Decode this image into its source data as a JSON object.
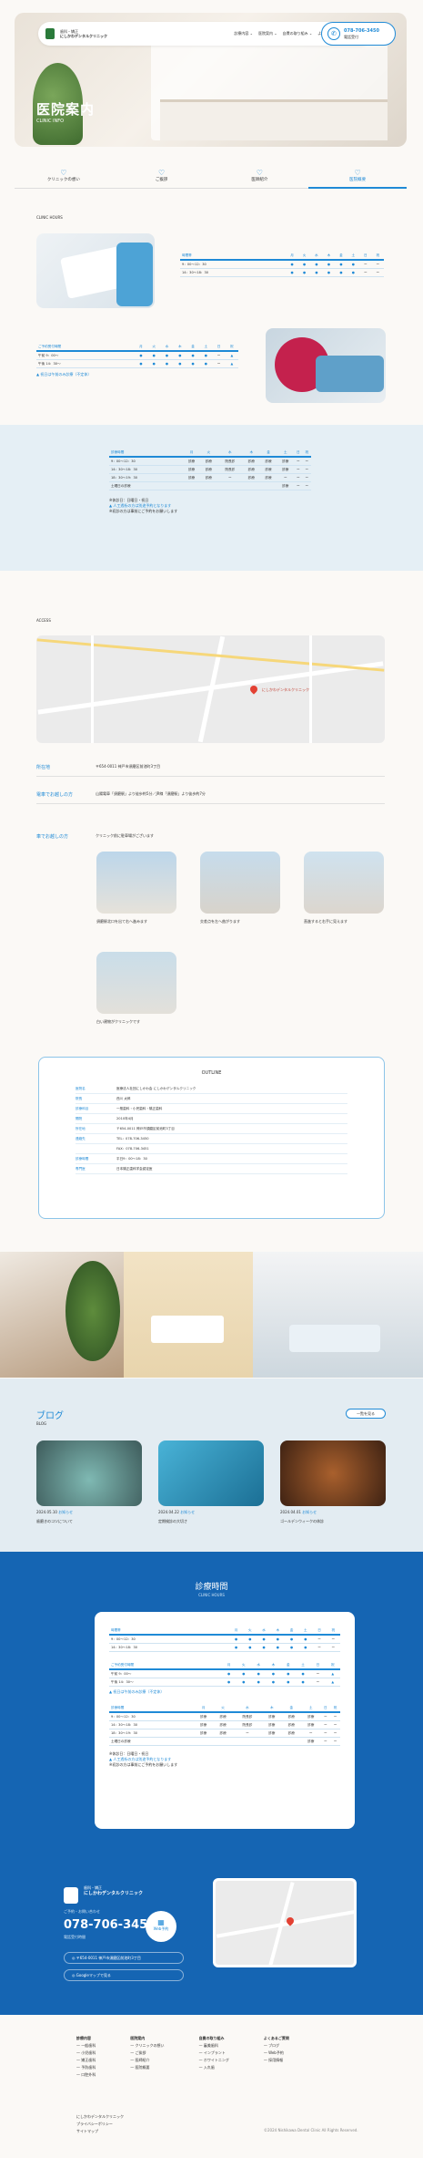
{
  "header": {
    "clinic_small": "歯科・矯正",
    "clinic_name": "にしかわデンタルクリニック",
    "nav": [
      "診療内容 ⌄",
      "医院案内 ⌄",
      "自費の取り組み ⌄",
      "よくあるご質問",
      "Web予約"
    ],
    "tel_label": "078-706-3450",
    "tel_sub": "電話受付"
  },
  "hero": {
    "title": "医院案内",
    "subtitle": "CLINIC INFO"
  },
  "tabs": [
    {
      "icon": "♡",
      "label": "クリニックの想い"
    },
    {
      "icon": "♡",
      "label": "ご挨拶"
    },
    {
      "icon": "♡",
      "label": "医師紹介"
    },
    {
      "icon": "♡",
      "label": "医院概要"
    }
  ],
  "hours_section": {
    "heading": "CLINIC HOURS"
  },
  "table1": {
    "head": [
      "時間帯",
      "月",
      "火",
      "水",
      "木",
      "金",
      "土",
      "日",
      "祝"
    ],
    "rows": [
      [
        "9：00〜12：30",
        "●",
        "●",
        "●",
        "●",
        "●",
        "●",
        "ー",
        "ー"
      ],
      [
        "14：30〜18：30",
        "●",
        "●",
        "●",
        "●",
        "●",
        "●",
        "ー",
        "ー"
      ]
    ]
  },
  "table2": {
    "head": [
      "ご予約受付時間",
      "月",
      "火",
      "水",
      "木",
      "金",
      "土",
      "日",
      "祝"
    ],
    "rows": [
      [
        "午前 9：00〜",
        "●",
        "●",
        "●",
        "●",
        "●",
        "●",
        "ー",
        "▲"
      ],
      [
        "午後 14：30〜",
        "●",
        "●",
        "●",
        "●",
        "●",
        "●",
        "ー",
        "▲"
      ]
    ],
    "note": "▲ 祝日は午前のみ診療（不定休）"
  },
  "table3": {
    "head": [
      "診療時間",
      "月",
      "火",
      "水",
      "木",
      "金",
      "土",
      "日",
      "祝"
    ],
    "rows": [
      [
        "9：00〜12：30",
        "診療",
        "診療",
        "院長診",
        "診療",
        "診療",
        "診療",
        "ー",
        "ー"
      ],
      [
        "14：30〜18：30",
        "診療",
        "診療",
        "院長診",
        "診療",
        "診療",
        "診療",
        "ー",
        "ー"
      ],
      [
        "18：30〜19：30",
        "診療",
        "診療",
        "ー",
        "診療",
        "診療",
        "ー",
        "ー",
        "ー"
      ],
      [
        "土曜日の診療",
        "",
        "",
        "",
        "",
        "",
        "診療",
        "ー",
        "ー"
      ]
    ],
    "notes": [
      "※休診日：日曜日・祝日",
      "▲ 人工透析の方は別途予約となります",
      "※初診の方は事前にご予約をお願いします"
    ]
  },
  "access": {
    "heading": "ACCESS",
    "map_label": "にしかわデンタルクリニック",
    "rows": [
      {
        "k": "所在地",
        "v": "〒654-0011 神戸市須磨区前池町3丁目"
      },
      {
        "k": "電車でお越しの方",
        "v": "山陽電車「須磨駅」より徒歩約5分／JR線「須磨駅」より徒歩約7分"
      },
      {
        "k": "車でお越しの方",
        "v": "クリニック前に駐車場がございます"
      }
    ],
    "steps": [
      "須磨駅北口を出て右へ進みます",
      "交差点を左へ曲がります",
      "直進すると右手に見えます",
      "白い建物がクリニックです"
    ]
  },
  "outline": {
    "heading": "OUTLINE",
    "rows": [
      {
        "k": "医院名",
        "v": "医療法人社団にしかわ会 にしかわデンタルクリニック"
      },
      {
        "k": "院長",
        "v": "西川 太郎"
      },
      {
        "k": "診療科目",
        "v": "一般歯科・小児歯科・矯正歯科"
      },
      {
        "k": "開院",
        "v": "2010年4月"
      },
      {
        "k": "所在地",
        "v": "〒654-0011 神戸市須磨区前池町3丁目"
      },
      {
        "k": "連絡先",
        "v": "TEL：078-706-3450"
      },
      {
        "k": "",
        "v": "FAX：078-706-3451"
      },
      {
        "k": "診療時間",
        "v": "平日9：00〜18：30"
      },
      {
        "k": "専門医",
        "v": "日本矯正歯科学会認定医"
      }
    ]
  },
  "blog": {
    "heading": "ブログ",
    "sub": "BLOG",
    "more": "一覧を見る",
    "posts": [
      {
        "date": "2024.05.10",
        "tag": "お知らせ",
        "title": "歯磨きのコツについて"
      },
      {
        "date": "2024.04.22",
        "tag": "お知らせ",
        "title": "定期検診の大切さ"
      },
      {
        "date": "2024.04.01",
        "tag": "お知らせ",
        "title": "ゴールデンウィークの休診"
      }
    ]
  },
  "hours_block": {
    "heading": "診療時間",
    "sub": "CLINIC HOURS"
  },
  "contact": {
    "small": "歯科・矯正",
    "name": "にしかわデンタルクリニック",
    "tel_label": "ご予約・お問い合わせ",
    "tel": "078-706-3450",
    "tel_sub": "電話受付時間",
    "web": "Web予約",
    "address_btn": "〒654-0011 神戸市須磨区前池町3丁目",
    "map_btn": "Googleマップで見る"
  },
  "footer": {
    "cols": [
      [
        "診療内容",
        "一般歯科",
        "小児歯科",
        "矯正歯科",
        "予防歯科",
        "口腔外科"
      ],
      [
        "医院案内",
        "クリニックの想い",
        "ご挨拶",
        "医師紹介",
        "医院概要"
      ],
      [
        "自費の取り組み",
        "審美歯科",
        "インプラント",
        "ホワイトニング",
        "入れ歯"
      ],
      [
        "よくあるご質問",
        "ブログ",
        "Web予約",
        "採用情報"
      ]
    ],
    "links": [
      "にしかわデンタルクリニック",
      "プライバシーポリシー",
      "サイトマップ"
    ],
    "copy": "©2024 Nishikawa Dental Clinic All Rights Reserved."
  }
}
